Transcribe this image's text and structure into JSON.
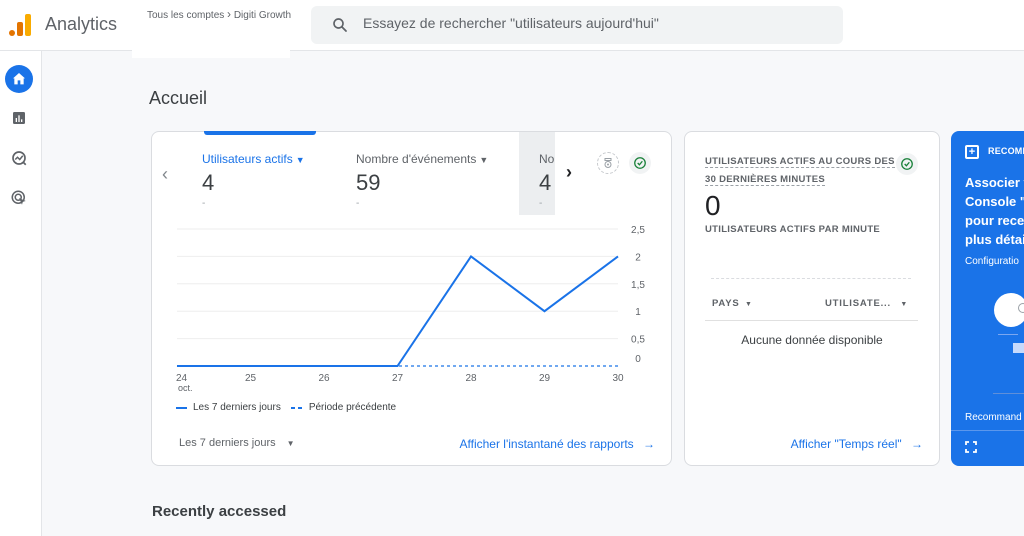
{
  "header": {
    "app_title": "Analytics",
    "breadcrumb": {
      "parent": "Tous les comptes",
      "separator": "›",
      "current": "Digiti Growth"
    },
    "search": {
      "placeholder": "Essayez de rechercher \"utilisateurs aujourd'hui\"",
      "value": ""
    }
  },
  "rail": {
    "items": [
      {
        "name": "home",
        "label": "Accueil",
        "active": true
      },
      {
        "name": "reports",
        "label": "Rapports",
        "active": false
      },
      {
        "name": "explore",
        "label": "Explorer",
        "active": false
      },
      {
        "name": "advertising",
        "label": "Publicité",
        "active": false
      }
    ]
  },
  "page": {
    "title": "Accueil",
    "recently_accessed": "Recently accessed"
  },
  "overview_card": {
    "metrics": [
      {
        "label": "Utilisateurs actifs",
        "value": "4",
        "delta": "-",
        "active": true
      },
      {
        "label": "Nombre d'événements",
        "value": "59",
        "delta": "-",
        "active": false
      },
      {
        "label": "No",
        "value": "4",
        "delta": "-",
        "active": false
      }
    ],
    "legend": {
      "current": "Les 7 derniers jours",
      "previous": "Période précédente"
    },
    "period_select": "Les 7 derniers jours",
    "report_link": "Afficher l'instantané des rapports",
    "arrow": "→"
  },
  "chart_data": {
    "type": "line",
    "title": "",
    "xlabel": "",
    "ylabel": "",
    "categories": [
      "24",
      "25",
      "26",
      "27",
      "28",
      "29",
      "30"
    ],
    "x_sublabel_first": "oct.",
    "y_ticks": [
      "0",
      "0,5",
      "1",
      "1,5",
      "2",
      "2,5"
    ],
    "ylim": [
      0,
      2.5
    ],
    "grid": true,
    "legend_position": "bottom-left",
    "series": [
      {
        "name": "Les 7 derniers jours",
        "style": "solid",
        "color": "#1a73e8",
        "values": [
          0,
          0,
          0,
          0,
          2,
          1,
          2
        ]
      },
      {
        "name": "Période précédente",
        "style": "dashed",
        "color": "#1a73e8",
        "values": [
          0,
          0,
          0,
          0,
          0,
          0,
          0
        ]
      }
    ]
  },
  "realtime_card": {
    "title_line1": "UTILISATEURS ACTIFS AU COURS DES",
    "title_line2": "30 DERNIÈRES MINUTES",
    "value": "0",
    "subtitle": "UTILISATEURS ACTIFS PAR MINUTE",
    "columns": [
      {
        "label": "PAYS"
      },
      {
        "label": "UTILISATE..."
      }
    ],
    "empty_text": "Aucune donnée disponible",
    "link": "Afficher \"Temps réel\"",
    "arrow": "→"
  },
  "recommendation_card": {
    "label": "RECOMMANDATION",
    "title_lines": [
      "Associer v",
      "Console \"I",
      "pour recev",
      "plus détai"
    ],
    "description": "Configuratio",
    "footer": "Recommand"
  },
  "colors": {
    "accent": "#1a73e8",
    "success": "#188038",
    "logo_orange": "#f9ab00",
    "logo_dark_orange": "#e37400"
  }
}
